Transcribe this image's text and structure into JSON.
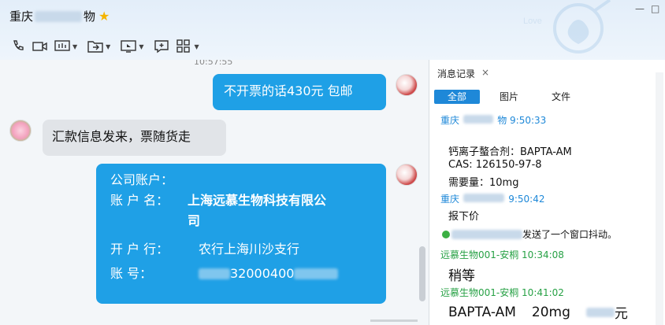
{
  "window": {
    "title_prefix": "重庆",
    "title_suffix": "物",
    "star": "★",
    "min_label": "—",
    "max_label": "□"
  },
  "toolbar": {
    "icons": [
      "phone-icon",
      "video-icon",
      "screen-share-icon",
      "file-transfer-icon",
      "remote-desktop-icon",
      "add-comment-icon",
      "apps-grid-icon"
    ]
  },
  "chat": {
    "timestamp": "10:57:55",
    "msg1": "不开票的话430元  包邮",
    "msg2": "汇款信息发来，票随货走",
    "msg3": {
      "line1": "公司账户：",
      "name_label": "账 户 名：",
      "name_value_1": "上海远慕生物科技有限公",
      "name_value_2": "司",
      "bank_label": "开 户 行：",
      "bank_value": "农行上海川沙支行",
      "acct_label": "账      号：",
      "acct_value": "32000400"
    }
  },
  "side": {
    "tab_label": "消息记录",
    "close": "×",
    "filters": [
      "全部",
      "图片",
      "文件"
    ],
    "log": [
      {
        "name": "重庆",
        "name_tail": "物 9:50:33"
      },
      {
        "text": "钙离子螯合剂：BAPTA-AM"
      },
      {
        "text": "CAS: 126150-97-8"
      },
      {
        "text": "需要量：10mg"
      },
      {
        "name": "重庆",
        "name_tail": " 9:50:42"
      },
      {
        "text": "报下价"
      },
      {
        "text": "发送了一个窗口抖动。"
      },
      {
        "name": "远慕生物001-安桐 10:34:08"
      },
      {
        "text": "稍等"
      },
      {
        "name": "远慕生物001-安桐 10:41:02"
      },
      {
        "text1": "BAPTA-AM",
        "text2": "20mg",
        "text3": "元"
      }
    ]
  },
  "colors": {
    "accent": "#1fa0e6",
    "link_blue": "#1e88d8",
    "green_name": "#27a145"
  }
}
